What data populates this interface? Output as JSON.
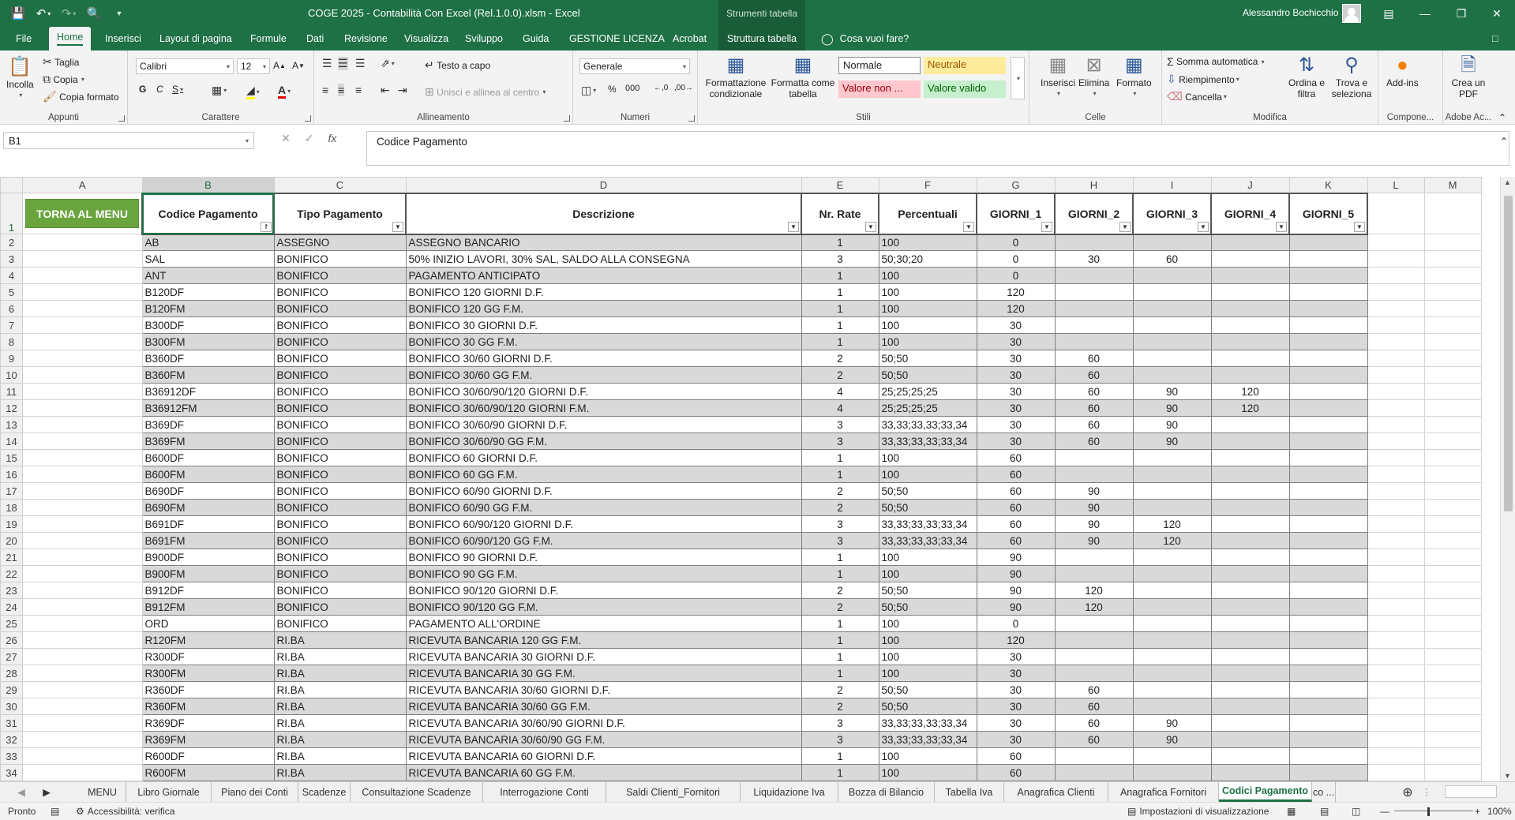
{
  "window": {
    "title": "COGE 2025 - Contabilità Con Excel (Rel.1.0.0).xlsm  -  Excel",
    "context_header": "Strumenti tabella",
    "user": "Alessandro Bochicchio"
  },
  "tabs": [
    "File",
    "Home",
    "Inserisci",
    "Layout di pagina",
    "Formule",
    "Dati",
    "Revisione",
    "Visualizza",
    "Sviluppo",
    "Guida",
    "GESTIONE LICENZA",
    "Acrobat",
    "Struttura tabella"
  ],
  "tell_me": "Cosa vuoi fare?",
  "ribbon": {
    "appunti": {
      "label": "Appunti",
      "incolla": "Incolla",
      "taglia": "Taglia",
      "copia": "Copia",
      "copia_formato": "Copia formato"
    },
    "carattere": {
      "label": "Carattere",
      "font": "Calibri",
      "size": "12"
    },
    "allineamento": {
      "label": "Allineamento",
      "testo_a_capo": "Testo a capo",
      "unisci": "Unisci e allinea al centro"
    },
    "numeri": {
      "label": "Numeri",
      "format": "Generale"
    },
    "stili": {
      "label": "Stili",
      "formattazione": "Formattazione condizionale",
      "formatta_tabella": "Formatta come tabella",
      "normale": "Normale",
      "neutrale": "Neutrale",
      "valore_non": "Valore non ...",
      "valore_valido": "Valore valido"
    },
    "celle": {
      "label": "Celle",
      "inserisci": "Inserisci",
      "elimina": "Elimina",
      "formato": "Formato"
    },
    "modifica": {
      "label": "Modifica",
      "somma": "Somma automatica",
      "riempimento": "Riempimento",
      "cancella": "Cancella",
      "ordina": "Ordina e filtra",
      "trova": "Trova e seleziona"
    },
    "componenti": {
      "label": "Compone...",
      "addins": "Add-ins"
    },
    "adobe": {
      "label": "Adobe Ac...",
      "crea_pdf": "Crea un PDF"
    }
  },
  "formula_bar": {
    "name_box": "B1",
    "content": "Codice Pagamento"
  },
  "columns": [
    "A",
    "B",
    "C",
    "D",
    "E",
    "F",
    "G",
    "H",
    "I",
    "J",
    "K",
    "L",
    "M"
  ],
  "sheet": {
    "menu_button": "TORNA AL MENU",
    "headers": [
      "Codice Pagamento",
      "Tipo Pagamento",
      "Descrizione",
      "Nr. Rate",
      "Percentuali",
      "GIORNI_1",
      "GIORNI_2",
      "GIORNI_3",
      "GIORNI_4",
      "GIORNI_5"
    ],
    "rows": [
      [
        "AB",
        "ASSEGNO",
        "ASSEGNO BANCARIO",
        "1",
        "100",
        "0",
        "",
        "",
        "",
        ""
      ],
      [
        "SAL",
        "BONIFICO",
        "50% INIZIO LAVORI, 30% SAL, SALDO ALLA CONSEGNA",
        "3",
        "50;30;20",
        "0",
        "30",
        "60",
        "",
        ""
      ],
      [
        "ANT",
        "BONIFICO",
        "PAGAMENTO ANTICIPATO",
        "1",
        "100",
        "0",
        "",
        "",
        "",
        ""
      ],
      [
        "B120DF",
        "BONIFICO",
        "BONIFICO 120 GIORNI D.F.",
        "1",
        "100",
        "120",
        "",
        "",
        "",
        ""
      ],
      [
        "B120FM",
        "BONIFICO",
        "BONIFICO 120 GG F.M.",
        "1",
        "100",
        "120",
        "",
        "",
        "",
        ""
      ],
      [
        "B300DF",
        "BONIFICO",
        "BONIFICO 30 GIORNI D.F.",
        "1",
        "100",
        "30",
        "",
        "",
        "",
        ""
      ],
      [
        "B300FM",
        "BONIFICO",
        "BONIFICO 30 GG F.M.",
        "1",
        "100",
        "30",
        "",
        "",
        "",
        ""
      ],
      [
        "B360DF",
        "BONIFICO",
        "BONIFICO 30/60 GIORNI D.F.",
        "2",
        "50;50",
        "30",
        "60",
        "",
        "",
        ""
      ],
      [
        "B360FM",
        "BONIFICO",
        "BONIFICO 30/60 GG F.M.",
        "2",
        "50;50",
        "30",
        "60",
        "",
        "",
        ""
      ],
      [
        "B36912DF",
        "BONIFICO",
        "BONIFICO 30/60/90/120 GIORNI D.F.",
        "4",
        "25;25;25;25",
        "30",
        "60",
        "90",
        "120",
        ""
      ],
      [
        "B36912FM",
        "BONIFICO",
        "BONIFICO 30/60/90/120 GIORNI F.M.",
        "4",
        "25;25;25;25",
        "30",
        "60",
        "90",
        "120",
        ""
      ],
      [
        "B369DF",
        "BONIFICO",
        "BONIFICO 30/60/90 GIORNI D.F.",
        "3",
        "33,33;33,33;33,34",
        "30",
        "60",
        "90",
        "",
        ""
      ],
      [
        "B369FM",
        "BONIFICO",
        "BONIFICO 30/60/90 GG F.M.",
        "3",
        "33,33;33,33;33,34",
        "30",
        "60",
        "90",
        "",
        ""
      ],
      [
        "B600DF",
        "BONIFICO",
        "BONIFICO 60 GIORNI D.F.",
        "1",
        "100",
        "60",
        "",
        "",
        "",
        ""
      ],
      [
        "B600FM",
        "BONIFICO",
        "BONIFICO 60 GG F.M.",
        "1",
        "100",
        "60",
        "",
        "",
        "",
        ""
      ],
      [
        "B690DF",
        "BONIFICO",
        "BONIFICO 60/90 GIORNI D.F.",
        "2",
        "50;50",
        "60",
        "90",
        "",
        "",
        ""
      ],
      [
        "B690FM",
        "BONIFICO",
        "BONIFICO 60/90 GG F.M.",
        "2",
        "50;50",
        "60",
        "90",
        "",
        "",
        ""
      ],
      [
        "B691DF",
        "BONIFICO",
        "BONIFICO 60/90/120 GIORNI D.F.",
        "3",
        "33,33;33,33;33,34",
        "60",
        "90",
        "120",
        "",
        ""
      ],
      [
        "B691FM",
        "BONIFICO",
        "BONIFICO 60/90/120 GG F.M.",
        "3",
        "33,33;33,33;33,34",
        "60",
        "90",
        "120",
        "",
        ""
      ],
      [
        "B900DF",
        "BONIFICO",
        "BONIFICO 90 GIORNI D.F.",
        "1",
        "100",
        "90",
        "",
        "",
        "",
        ""
      ],
      [
        "B900FM",
        "BONIFICO",
        "BONIFICO 90 GG F.M.",
        "1",
        "100",
        "90",
        "",
        "",
        "",
        ""
      ],
      [
        "B912DF",
        "BONIFICO",
        "BONIFICO 90/120 GIORNI D.F.",
        "2",
        "50;50",
        "90",
        "120",
        "",
        "",
        ""
      ],
      [
        "B912FM",
        "BONIFICO",
        "BONIFICO 90/120 GG F.M.",
        "2",
        "50;50",
        "90",
        "120",
        "",
        "",
        ""
      ],
      [
        "ORD",
        "BONIFICO",
        "PAGAMENTO ALL'ORDINE",
        "1",
        "100",
        "0",
        "",
        "",
        "",
        ""
      ],
      [
        "R120FM",
        "RI.BA",
        "RICEVUTA BANCARIA 120 GG F.M.",
        "1",
        "100",
        "120",
        "",
        "",
        "",
        ""
      ],
      [
        "R300DF",
        "RI.BA",
        "RICEVUTA BANCARIA 30 GIORNI D.F.",
        "1",
        "100",
        "30",
        "",
        "",
        "",
        ""
      ],
      [
        "R300FM",
        "RI.BA",
        "RICEVUTA BANCARIA 30 GG F.M.",
        "1",
        "100",
        "30",
        "",
        "",
        "",
        ""
      ],
      [
        "R360DF",
        "RI.BA",
        "RICEVUTA BANCARIA 30/60 GIORNI D.F.",
        "2",
        "50;50",
        "30",
        "60",
        "",
        "",
        ""
      ],
      [
        "R360FM",
        "RI.BA",
        "RICEVUTA BANCARIA 30/60 GG F.M.",
        "2",
        "50;50",
        "30",
        "60",
        "",
        "",
        ""
      ],
      [
        "R369DF",
        "RI.BA",
        "RICEVUTA BANCARIA 30/60/90 GIORNI D.F.",
        "3",
        "33,33;33,33;33,34",
        "30",
        "60",
        "90",
        "",
        ""
      ],
      [
        "R369FM",
        "RI.BA",
        "RICEVUTA BANCARIA 30/60/90 GG F.M.",
        "3",
        "33,33;33,33;33,34",
        "30",
        "60",
        "90",
        "",
        ""
      ],
      [
        "R600DF",
        "RI.BA",
        "RICEVUTA BANCARIA 60 GIORNI D.F.",
        "1",
        "100",
        "60",
        "",
        "",
        "",
        ""
      ],
      [
        "R600FM",
        "RI.BA",
        "RICEVUTA BANCARIA 60 GG F.M.",
        "1",
        "100",
        "60",
        "",
        "",
        "",
        ""
      ]
    ]
  },
  "sheet_tabs": [
    "MENU",
    "Libro Giornale",
    "Piano dei Conti",
    "Scadenze",
    "Consultazione Scadenze",
    "Interrogazione Conti",
    "Saldi Clienti_Fornitori",
    "Liquidazione Iva",
    "Bozza di Bilancio",
    "Tabella Iva",
    "Anagrafica Clienti",
    "Anagrafica Fornitori",
    "Codici Pagamento",
    "co ..."
  ],
  "active_sheet": "Codici Pagamento",
  "status": {
    "ready": "Pronto",
    "accessibility": "Accessibilità: verifica",
    "display_settings": "Impostazioni di visualizzazione",
    "zoom": "100%"
  },
  "colors": {
    "excel_green": "#1e7145",
    "band": "#d9d9d9",
    "menu_button": "#6aa43f"
  }
}
